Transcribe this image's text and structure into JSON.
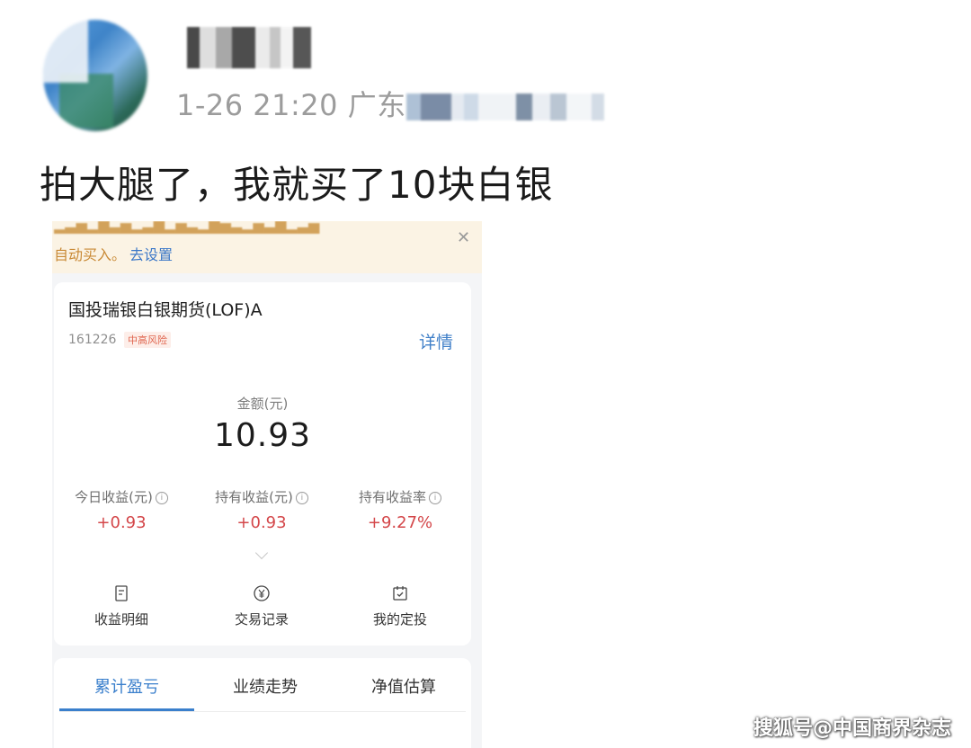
{
  "post": {
    "meta": "1-26 21:20 广东",
    "text": "拍大腿了，我就买了10块白银"
  },
  "app": {
    "banner": {
      "text": "自动买入。",
      "link": "去设置",
      "close_icon": "close-icon"
    },
    "fund": {
      "name": "国投瑞银白银期货(LOF)A",
      "code": "161226",
      "risk": "中高风险",
      "detail_link": "详情"
    },
    "amount": {
      "label": "金额(元)",
      "value": "10.93"
    },
    "metrics": [
      {
        "label": "今日收益(元)",
        "value": "+0.93"
      },
      {
        "label": "持有收益(元)",
        "value": "+0.93"
      },
      {
        "label": "持有收益率",
        "value": "+9.27%"
      }
    ],
    "actions": [
      {
        "label": "收益明细",
        "icon": "document-icon"
      },
      {
        "label": "交易记录",
        "icon": "yen-circle-icon"
      },
      {
        "label": "我的定投",
        "icon": "calendar-check-icon"
      }
    ],
    "tabs": [
      {
        "label": "累计盈亏",
        "active": true
      },
      {
        "label": "业绩走势",
        "active": false
      },
      {
        "label": "净值估算",
        "active": false
      }
    ]
  },
  "watermark": "搜狐号@中国商界杂志",
  "colors": {
    "accent_blue": "#3a7fcc",
    "gain_red": "#d4474a",
    "banner_bg": "#fbf3e4",
    "banner_text": "#c98a36"
  }
}
